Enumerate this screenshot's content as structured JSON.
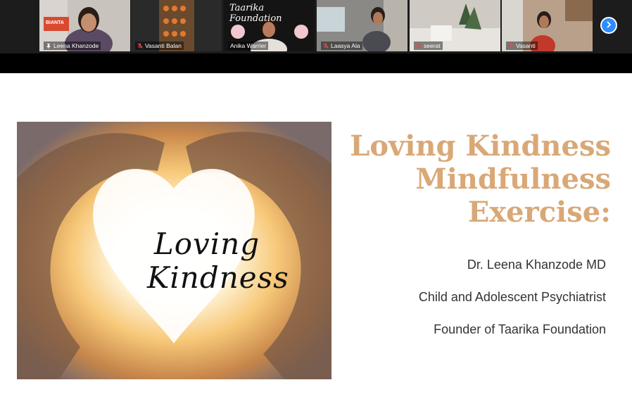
{
  "participants": [
    {
      "name": "Leena Khanzode",
      "muted": false,
      "pinned": true
    },
    {
      "name": "Vasanti Balan",
      "muted": true
    },
    {
      "name": "Anika Warrier",
      "muted": false
    },
    {
      "name": "Laasya Ala",
      "muted": true
    },
    {
      "name": "seerat",
      "muted": true
    },
    {
      "name": "Vasanti",
      "muted": true
    }
  ],
  "badge_text": "BIANTA",
  "poster_text": "Taarika Foundation",
  "slide": {
    "image_caption_line1": "Loving",
    "image_caption_line2": "Kindness",
    "title_line1": "Loving Kindness",
    "title_line2": "Mindfulness",
    "title_line3": "Exercise:",
    "presenter": "Dr. Leena Khanzode MD",
    "role": "Child and Adolescent Psychiatrist",
    "org": "Founder of Taarika Foundation"
  },
  "colors": {
    "title": "#d9a877",
    "active_speaker": "#3fb950",
    "accent": "#2d8cff",
    "muted_icon": "#e5484d"
  },
  "icons": {
    "next": "chevron-right-icon",
    "muted": "mic-muted-icon",
    "pin": "pin-icon"
  }
}
